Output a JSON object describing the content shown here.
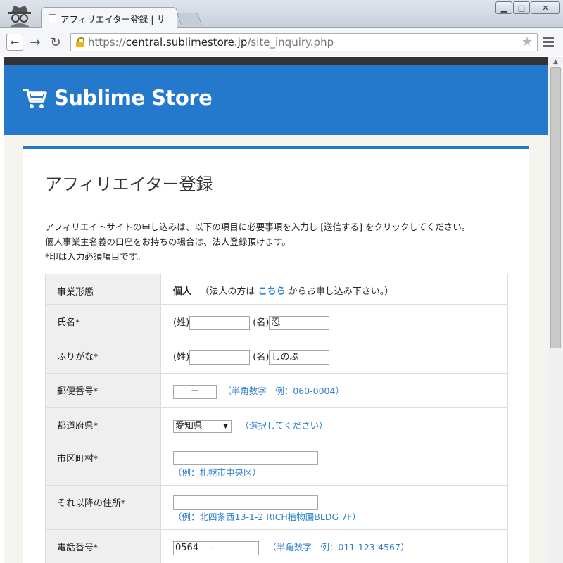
{
  "browser": {
    "tab_title": "アフィリエイター登録 | サ",
    "url_scheme": "https://",
    "url_host": "central.sublimestore.jp",
    "url_path": "/site_inquiry.php"
  },
  "colors": {
    "brand_blue": "#2479cd",
    "link_blue": "#2f7fd0"
  },
  "header": {
    "logo_text": "Sublime Store"
  },
  "page": {
    "title": "アフィリエイター登録",
    "intro_line1": "アフィリエイトサイトの申し込みは、以下の項目に必要事項を入力し [送信する] をクリックしてください。",
    "intro_line2": "個人事業主名義の口座をお持ちの場合は、法人登録頂けます。",
    "intro_line3": "*印は入力必須項目です。"
  },
  "form": {
    "required_mark": "*",
    "business_type": {
      "label": "事業形態",
      "value": "個人",
      "note_pre": "（法人の方は",
      "note_link": "こちら",
      "note_post": "からお申し込み下さい。）"
    },
    "name": {
      "label": "氏名",
      "sei_label": "(姓)",
      "mei_label": "(名)",
      "sei_value": "",
      "mei_value": "忍"
    },
    "furigana": {
      "label": "ふりがな",
      "sei_label": "(姓)",
      "mei_label": "(名)",
      "sei_value": "",
      "mei_value": "しのぶ"
    },
    "postal": {
      "label": "郵便番号",
      "value": "－",
      "hint": "（半角数字　例：060-0004）"
    },
    "prefecture": {
      "label": "都道府県",
      "selected": "愛知県",
      "hint": "（選択してください）"
    },
    "city": {
      "label": "市区町村",
      "value": "",
      "hint": "（例：札幌市中央区）"
    },
    "address": {
      "label": "それ以降の住所",
      "value": "",
      "hint": "（例：北四条西13-1-2 RICH植物園BLDG 7F）"
    },
    "phone": {
      "label": "電話番号",
      "value": "0564-　-",
      "hint": "（半角数字　例：011-123-4567）"
    }
  }
}
